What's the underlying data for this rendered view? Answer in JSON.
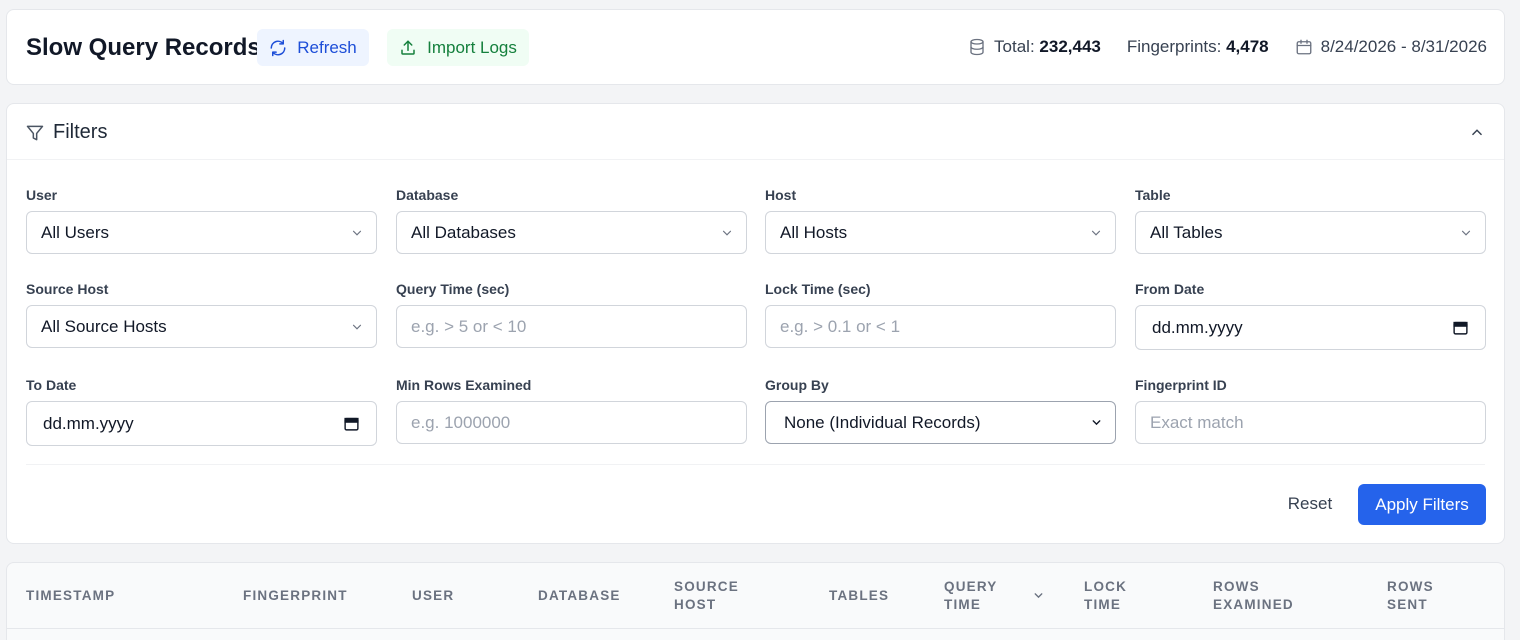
{
  "header": {
    "title": "Slow Query Records",
    "refresh_label": "Refresh",
    "import_label": "Import Logs",
    "total_label": "Total:",
    "total_value": "232,443",
    "fingerprints_label": "Fingerprints:",
    "fingerprints_value": "4,478",
    "date_range": "8/24/2026 - 8/31/2026"
  },
  "filters": {
    "title": "Filters",
    "user": {
      "label": "User",
      "value": "All Users"
    },
    "database": {
      "label": "Database",
      "value": "All Databases"
    },
    "host": {
      "label": "Host",
      "value": "All Hosts"
    },
    "table": {
      "label": "Table",
      "value": "All Tables"
    },
    "source_host": {
      "label": "Source Host",
      "value": "All Source Hosts"
    },
    "query_time": {
      "label": "Query Time (sec)",
      "placeholder": "e.g. > 5 or < 10"
    },
    "lock_time": {
      "label": "Lock Time (sec)",
      "placeholder": "e.g. > 0.1 or < 1"
    },
    "from_date": {
      "label": "From Date",
      "value": "dd.mm.yyyy"
    },
    "to_date": {
      "label": "To Date",
      "value": "dd.mm.yyyy"
    },
    "min_rows": {
      "label": "Min Rows Examined",
      "placeholder": "e.g. 1000000"
    },
    "group_by": {
      "label": "Group By",
      "value": "None (Individual Records)"
    },
    "fingerprint_id": {
      "label": "Fingerprint ID",
      "placeholder": "Exact match"
    },
    "reset_label": "Reset",
    "apply_label": "Apply Filters"
  },
  "table": {
    "columns": {
      "timestamp": "TIMESTAMP",
      "fingerprint": "FINGERPRINT",
      "user": "USER",
      "database": "DATABASE",
      "source_host_1": "SOURCE",
      "source_host_2": "HOST",
      "tables": "TABLES",
      "query_time_1": "QUERY",
      "query_time_2": "TIME",
      "lock_time_1": "LOCK",
      "lock_time_2": "TIME",
      "rows_examined_1": "ROWS",
      "rows_examined_2": "EXAMINED",
      "rows_sent_1": "ROWS",
      "rows_sent_2": "SENT"
    }
  },
  "colors": {
    "accent": "#2563eb",
    "refresh_bg": "#eef4ff",
    "import_bg": "#f0fdf4",
    "import_text": "#15803d"
  },
  "icons": [
    "refresh-icon",
    "upload-icon",
    "database-icon",
    "calendar-icon",
    "filter-icon",
    "chevron-up-icon",
    "chevron-down-icon"
  ]
}
